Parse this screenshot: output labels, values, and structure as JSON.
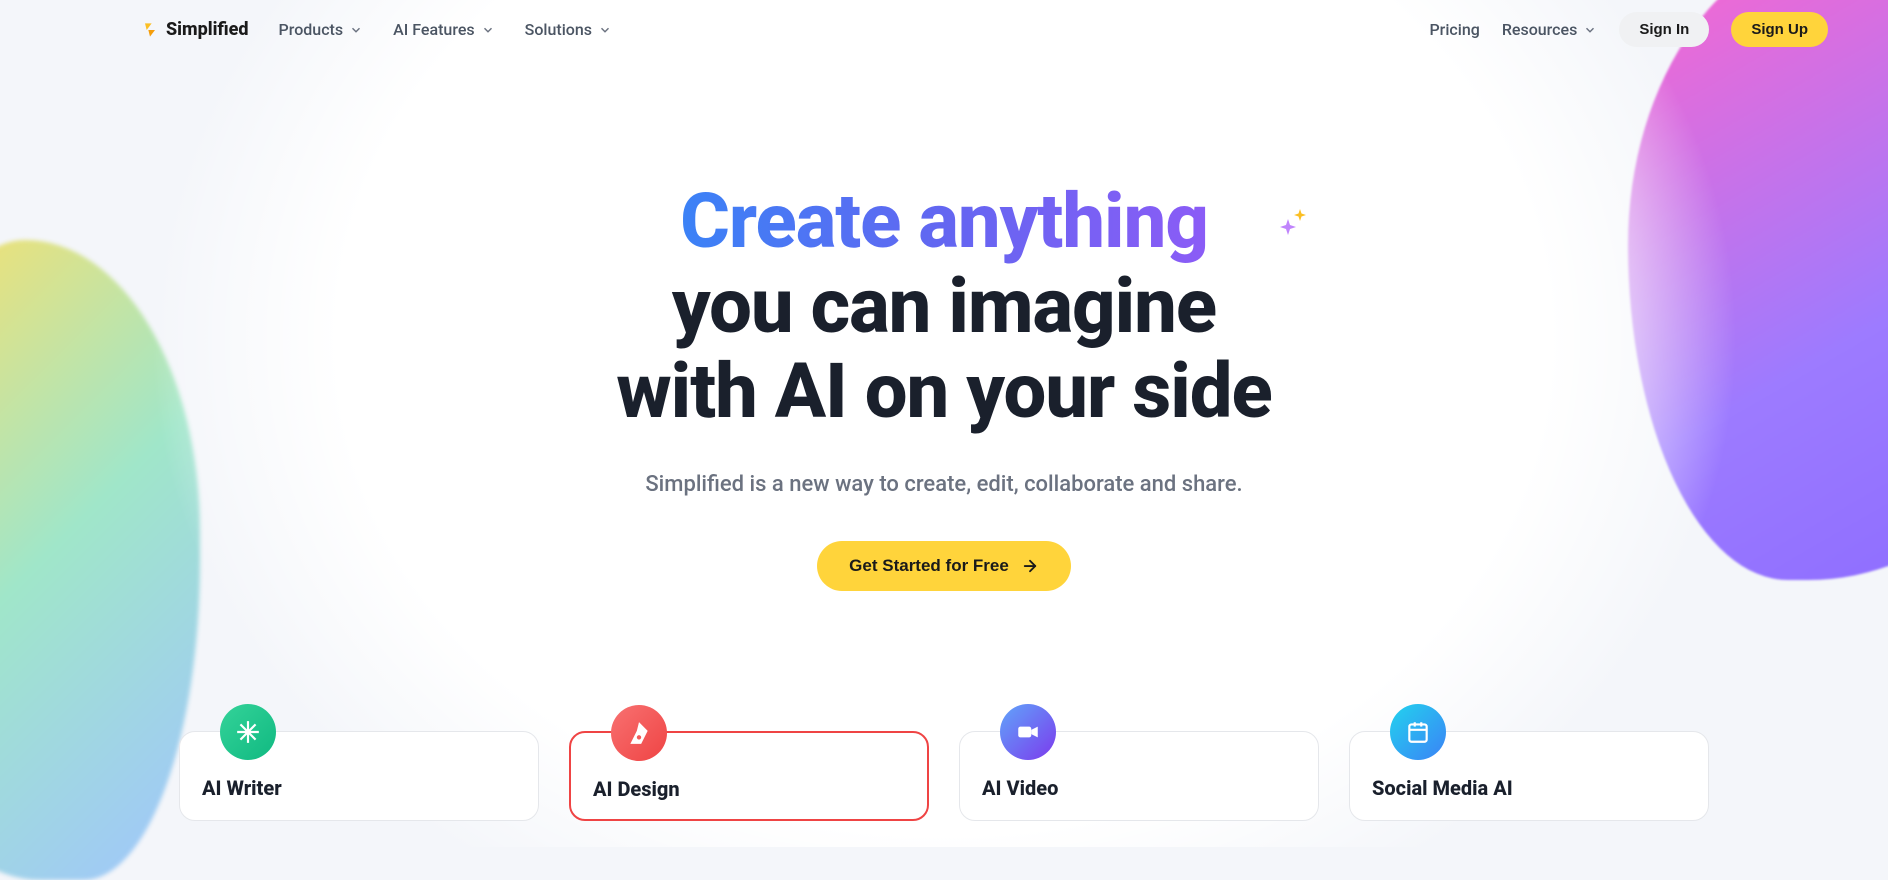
{
  "brand": {
    "name": "Simplified"
  },
  "nav": {
    "items": [
      {
        "label": "Products"
      },
      {
        "label": "AI Features"
      },
      {
        "label": "Solutions"
      }
    ],
    "links": {
      "pricing": "Pricing",
      "resources": "Resources"
    },
    "signin": "Sign In",
    "signup": "Sign Up"
  },
  "hero": {
    "gradient_line": "Create anything",
    "line2": "you can imagine",
    "line3": "with AI on your side",
    "subtitle": "Simplified is a new way to create, edit, collaborate and share.",
    "cta": "Get Started for Free"
  },
  "cards": [
    {
      "title": "AI Writer"
    },
    {
      "title": "AI Design"
    },
    {
      "title": "AI Video"
    },
    {
      "title": "Social Media AI"
    }
  ]
}
